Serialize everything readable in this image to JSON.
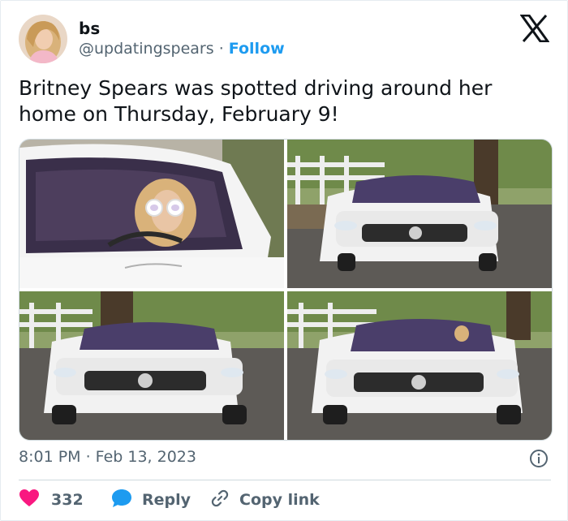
{
  "author": {
    "name": "bs",
    "handle": "@updatingspears",
    "separator": "·",
    "follow_label": "Follow"
  },
  "tweet": {
    "text": "Britney Spears was spotted driving around her home on Thursday, February 9!"
  },
  "media": {
    "photos": [
      {
        "alt": "Close-up of driver in white sunglasses behind windshield"
      },
      {
        "alt": "White Mercedes convertible driving on road, front view"
      },
      {
        "alt": "White Mercedes convertible on road near fence"
      },
      {
        "alt": "White Mercedes convertible approaching, driver visible"
      }
    ]
  },
  "meta": {
    "timestamp": "8:01 PM · Feb 13, 2023"
  },
  "actions": {
    "like_count": "332",
    "reply_label": "Reply",
    "copy_link_label": "Copy link"
  },
  "colors": {
    "accent": "#1d9bf0",
    "like": "#f91880",
    "secondary_text": "#536471"
  },
  "icons": [
    "x-logo-icon",
    "info-icon",
    "heart-icon",
    "reply-bubble-icon",
    "link-icon"
  ]
}
